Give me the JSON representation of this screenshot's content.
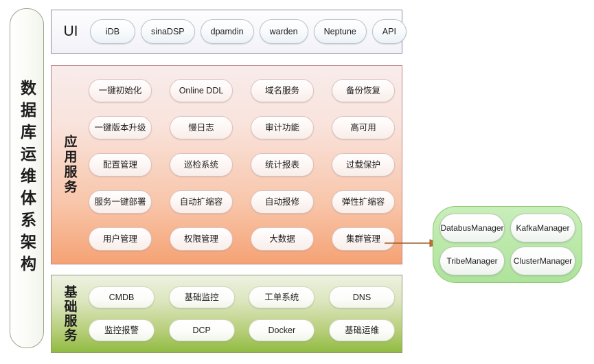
{
  "diagram": {
    "title_vertical": "数据库运维体系架构",
    "layers": [
      {
        "id": "ui",
        "label": "UI",
        "label_orientation": "horizontal",
        "border_color": "#8e8ba6",
        "items": [
          "iDB",
          "sinaDSP",
          "dpamdin",
          "warden",
          "Neptune",
          "API"
        ]
      },
      {
        "id": "app",
        "label": "应用服务",
        "label_orientation": "vertical",
        "border_color": "#b9848a",
        "gradient_from": "#f8eceb",
        "gradient_to": "#f5a274",
        "rows": [
          [
            "一键初始化",
            "Online DDL",
            "域名服务",
            "备份恢复"
          ],
          [
            "一键版本升级",
            "慢日志",
            "审计功能",
            "高可用"
          ],
          [
            "配置管理",
            "巡检系统",
            "统计报表",
            "过载保护"
          ],
          [
            "服务一键部署",
            "自动扩缩容",
            "自动报修",
            "弹性扩缩容"
          ],
          [
            "用户管理",
            "权限管理",
            "大数据",
            "集群管理"
          ]
        ]
      },
      {
        "id": "base",
        "label": "基础服务",
        "label_orientation": "vertical",
        "border_color": "#8f9a72",
        "gradient_from": "#eef1e1",
        "gradient_to": "#8fbb41",
        "rows": [
          [
            "CMDB",
            "基础监控",
            "工单系统",
            "DNS"
          ],
          [
            "监控报警",
            "DCP",
            "Docker",
            "基础运维"
          ]
        ]
      }
    ],
    "cluster_group": {
      "border_color": "#8bc46f",
      "fill_color": "#bbe9aa",
      "rows": [
        [
          {
            "line1": "Databus",
            "line2": "Manager"
          },
          {
            "line1": "Kafka",
            "line2": "Manager"
          }
        ],
        [
          {
            "line1": "Tribe",
            "line2": "Manager"
          },
          {
            "line1": "Cluster",
            "line2": "Manager"
          }
        ]
      ]
    },
    "connector": {
      "from": "集群管理",
      "to": "cluster-group",
      "color": "#9c5b28",
      "direction": "right"
    }
  }
}
